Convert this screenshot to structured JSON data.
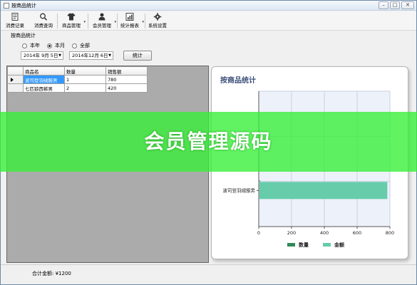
{
  "window": {
    "title": "按商品统计",
    "buttons": [
      "–",
      "□",
      "✕"
    ]
  },
  "toolbar": [
    {
      "label": "消费记录",
      "icon": "document-icon"
    },
    {
      "label": "消费查询",
      "icon": "search-icon"
    },
    {
      "label": "商品管理",
      "icon": "shirt-icon",
      "dropdown": true
    },
    {
      "label": "会员管理",
      "icon": "user-icon",
      "dropdown": true
    },
    {
      "label": "统计报表",
      "icon": "report-icon",
      "dropdown": true
    },
    {
      "label": "系统设置",
      "icon": "gear-icon"
    }
  ],
  "filter": {
    "group_title": "按商品统计",
    "radios": [
      {
        "label": "本年",
        "checked": false
      },
      {
        "label": "本月",
        "checked": true
      },
      {
        "label": "全部",
        "checked": false
      }
    ],
    "start_date": "2014年 9月 5日",
    "end_date": "2014年12月 6日",
    "stat_button": "统计"
  },
  "grid": {
    "columns": [
      "商品名",
      "数量",
      "销售额"
    ],
    "rows": [
      {
        "name": "波司登羽绒服男",
        "qty": "1",
        "amount": "780"
      },
      {
        "name": "七匹狼西裤男",
        "qty": "2",
        "amount": "420"
      }
    ]
  },
  "chart_data": {
    "type": "bar",
    "orientation": "horizontal",
    "title": "按商品统计",
    "categories": [
      "波司登羽绒服男"
    ],
    "series": [
      {
        "name": "数量",
        "values": [
          1
        ],
        "color": "#2f8a57"
      },
      {
        "name": "金额",
        "values": [
          780
        ],
        "color": "#66ccaa"
      }
    ],
    "x_ticks": [
      0,
      200,
      400,
      600,
      800
    ],
    "xlim": [
      0,
      800
    ],
    "grid": true,
    "legend": "bottom"
  },
  "footer": {
    "total": "合计金额: ¥1200"
  },
  "overlay": {
    "text": "会员管理源码",
    "color": "#34f034"
  }
}
